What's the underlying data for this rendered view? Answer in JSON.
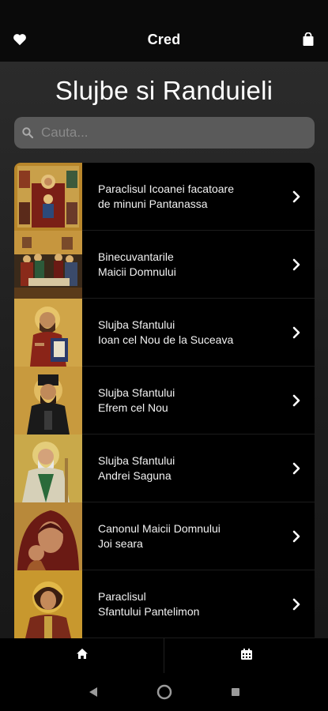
{
  "header": {
    "title": "Cred",
    "left_icon": "heart-icon",
    "right_icon": "shopping-bag-icon"
  },
  "page": {
    "title": "Slujbe si Randuieli"
  },
  "search": {
    "placeholder": "Cauta...",
    "value": ""
  },
  "items": [
    {
      "line1": "Paraclisul Icoanei facatoare",
      "line2": "de minuni Pantanassa",
      "thumb": "icon-theotokos-pantanassa"
    },
    {
      "line1": "Binecuvantarile",
      "line2": "Maicii Domnului",
      "thumb": "icon-dormition"
    },
    {
      "line1": "Slujba Sfantului",
      "line2": "Ioan cel Nou de la Suceava",
      "thumb": "icon-saint-john"
    },
    {
      "line1": "Slujba Sfantului",
      "line2": "Efrem cel Nou",
      "thumb": "icon-saint-ephraim"
    },
    {
      "line1": "Slujba Sfantului",
      "line2": "Andrei Saguna",
      "thumb": "icon-saint-andrei"
    },
    {
      "line1": "Canonul Maicii Domnului",
      "line2": "Joi seara",
      "thumb": "icon-virgin-mary"
    },
    {
      "line1": "Paraclisul",
      "line2": "Sfantului Pantelimon",
      "thumb": "icon-saint-panteleimon"
    }
  ],
  "tabs": [
    {
      "icon": "home-icon",
      "active": true
    },
    {
      "icon": "calendar-icon",
      "active": false
    }
  ],
  "system_nav": [
    "back-icon",
    "home-circle-icon",
    "recents-icon"
  ],
  "colors": {
    "background": "#1d1d1d",
    "list_bg": "#000000",
    "search_bg": "#5a5a5a",
    "icon_gold": "#b8892c",
    "icon_red": "#8a2a1a"
  }
}
